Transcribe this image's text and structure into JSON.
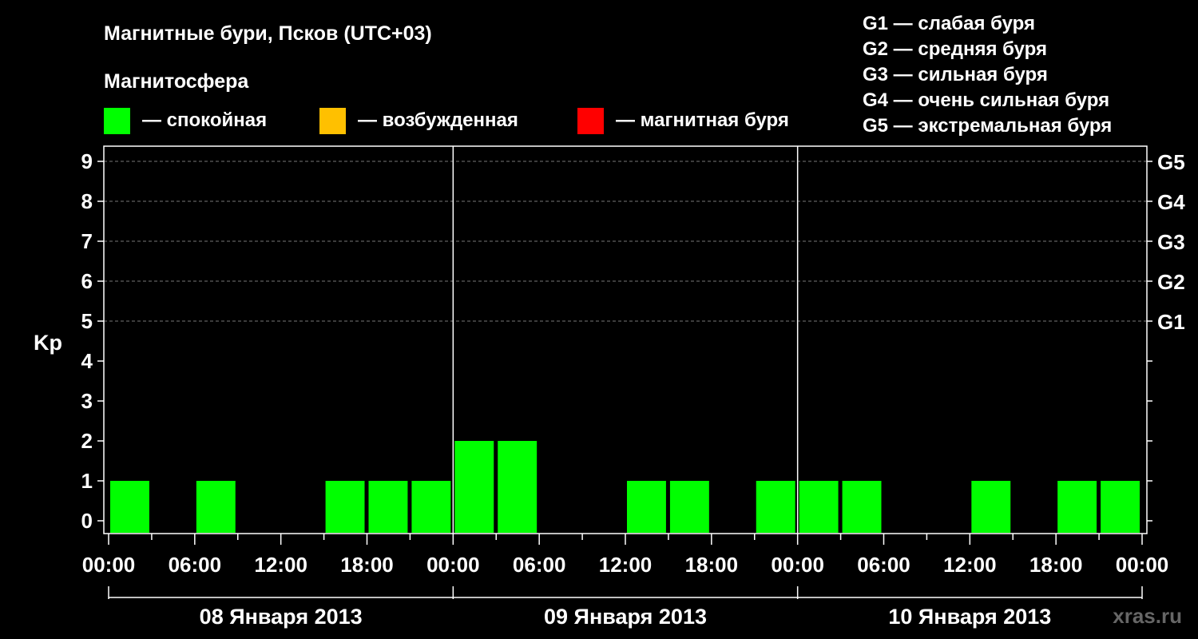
{
  "header": {
    "title": "Магнитные бури, Псков (UTC+03)",
    "subtitle": "Магнитосфера"
  },
  "legend": [
    {
      "color": "#00ff00",
      "label": "— спокойная"
    },
    {
      "color": "#ffc000",
      "label": "— возбужденная"
    },
    {
      "color": "#ff0000",
      "label": "— магнитная буря"
    }
  ],
  "storm_scale": [
    "G1 — слабая буря",
    "G2 — средняя буря",
    "G3 — сильная буря",
    "G4 — очень сильная буря",
    "G5 — экстремальная буря"
  ],
  "watermark": "xras.ru",
  "chart_data": {
    "type": "bar",
    "title": "Магнитные бури, Псков (UTC+03)",
    "ylabel": "Kp",
    "ylim": [
      0,
      9
    ],
    "y_ticks": [
      "0",
      "1",
      "2",
      "3",
      "4",
      "5",
      "6",
      "7",
      "8",
      "9"
    ],
    "g_levels": [
      {
        "label": "G1",
        "kp": 5
      },
      {
        "label": "G2",
        "kp": 6
      },
      {
        "label": "G3",
        "kp": 7
      },
      {
        "label": "G4",
        "kp": 8
      },
      {
        "label": "G5",
        "kp": 9
      }
    ],
    "x_tick_labels": [
      "00:00",
      "06:00",
      "12:00",
      "18:00",
      "00:00",
      "06:00",
      "12:00",
      "18:00",
      "00:00",
      "06:00",
      "12:00",
      "18:00",
      "00:00"
    ],
    "days": [
      "08 Января 2013",
      "09 Января 2013",
      "10 Января 2013"
    ],
    "interval_hours": 3,
    "bar_color": "#00ff00",
    "values": [
      1,
      0,
      1,
      0,
      0,
      1,
      1,
      1,
      2,
      2,
      0,
      0,
      1,
      1,
      0,
      1,
      1,
      1,
      0,
      0,
      1,
      0,
      1,
      1
    ],
    "grid": true
  }
}
